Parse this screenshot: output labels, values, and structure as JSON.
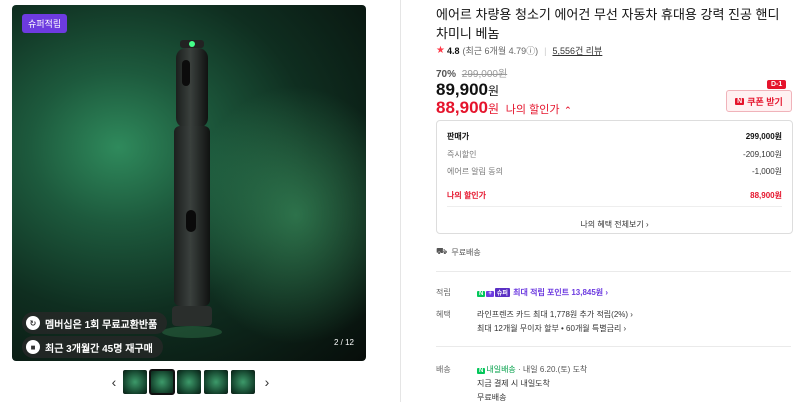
{
  "gallery": {
    "badge": "슈퍼적립",
    "chip1": {
      "icon": "refresh-icon",
      "text": "멤버십은 1회 무료교환반품"
    },
    "chip2": {
      "icon": "box-icon",
      "text": "최근 3개월간 45명 재구매"
    },
    "counter": "2 / 12",
    "thumb_count": 5
  },
  "product": {
    "title": "에어르 차량용 청소기 에어건 무선 자동차 휴대용 강력 진공 핸디 차미니 베놈",
    "rating": "4.8",
    "rating_note": "(최근 6개월 4.79ⓘ)",
    "review_count": "5,556건 리뷰",
    "discount_pct": "70%",
    "original_price": "299,000원",
    "sale_price": "89,900",
    "my_price": "88,900",
    "won": "원",
    "my_price_label": "나의 할인가",
    "coupon_label": "쿠폰 받기",
    "coupon_dday": "D-1"
  },
  "breakdown": {
    "rows": [
      {
        "label": "판매가",
        "value": "299,000원"
      },
      {
        "label": "즉시할인",
        "value": "-209,100원"
      },
      {
        "label": "에어르 알림 동의",
        "value": "-1,000원"
      }
    ],
    "total_label": "나의 할인가",
    "total_value": "88,900원",
    "more_label": "나의 혜택 전체보기 ›"
  },
  "shipping_note": "무료배송",
  "benefits": {
    "point_label": "적립",
    "point_text": "최대 적립 포인트 13,845원 ›",
    "benefit_label": "혜택",
    "benefit_line1": "라인프렌즈 카드 최대 1,778원 추가 적립(2%) ›",
    "benefit_line2": "최대 12개월 무이자 할부 • 60개월 특별금리 ›"
  },
  "delivery": {
    "label": "배송",
    "line1_tag": "내일배송",
    "line1_rest": "· 내일 6.20.(토) 도착",
    "line2": "지금 결제 시 내일도착",
    "line3": "무료배송"
  },
  "colors": {
    "accent_red": "#e5142c",
    "purple": "#6d3be0",
    "npay_green": "#03c75a"
  }
}
